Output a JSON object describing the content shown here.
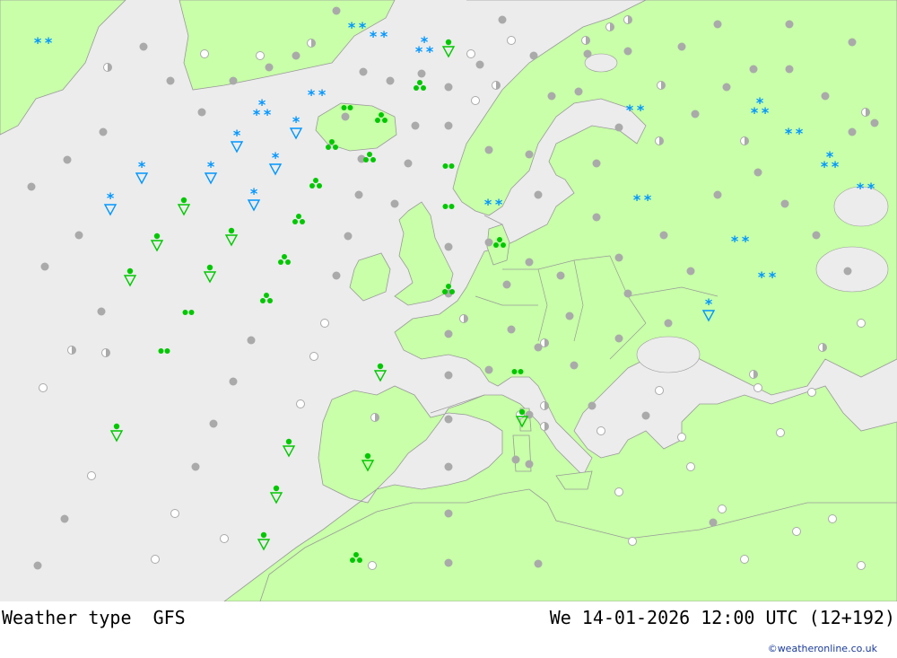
{
  "header": {
    "title": "Weather type  GFS",
    "valid_time": "We 14-01-2026 12:00 UTC (12+192)",
    "credit": "©weatheronline.co.uk"
  },
  "colors": {
    "sea": "#ececec",
    "land": "#c8ffa8",
    "border": "#9a9a9a",
    "cloud_symbol": "#aaaaaa",
    "rain_symbol": "#00c800",
    "snow_symbol": "#0096ff"
  },
  "legend_types": [
    "overcast",
    "partly-cloudy",
    "clear",
    "snow-showers",
    "snow-shower",
    "rain-shower",
    "showers",
    "drizzle"
  ]
}
